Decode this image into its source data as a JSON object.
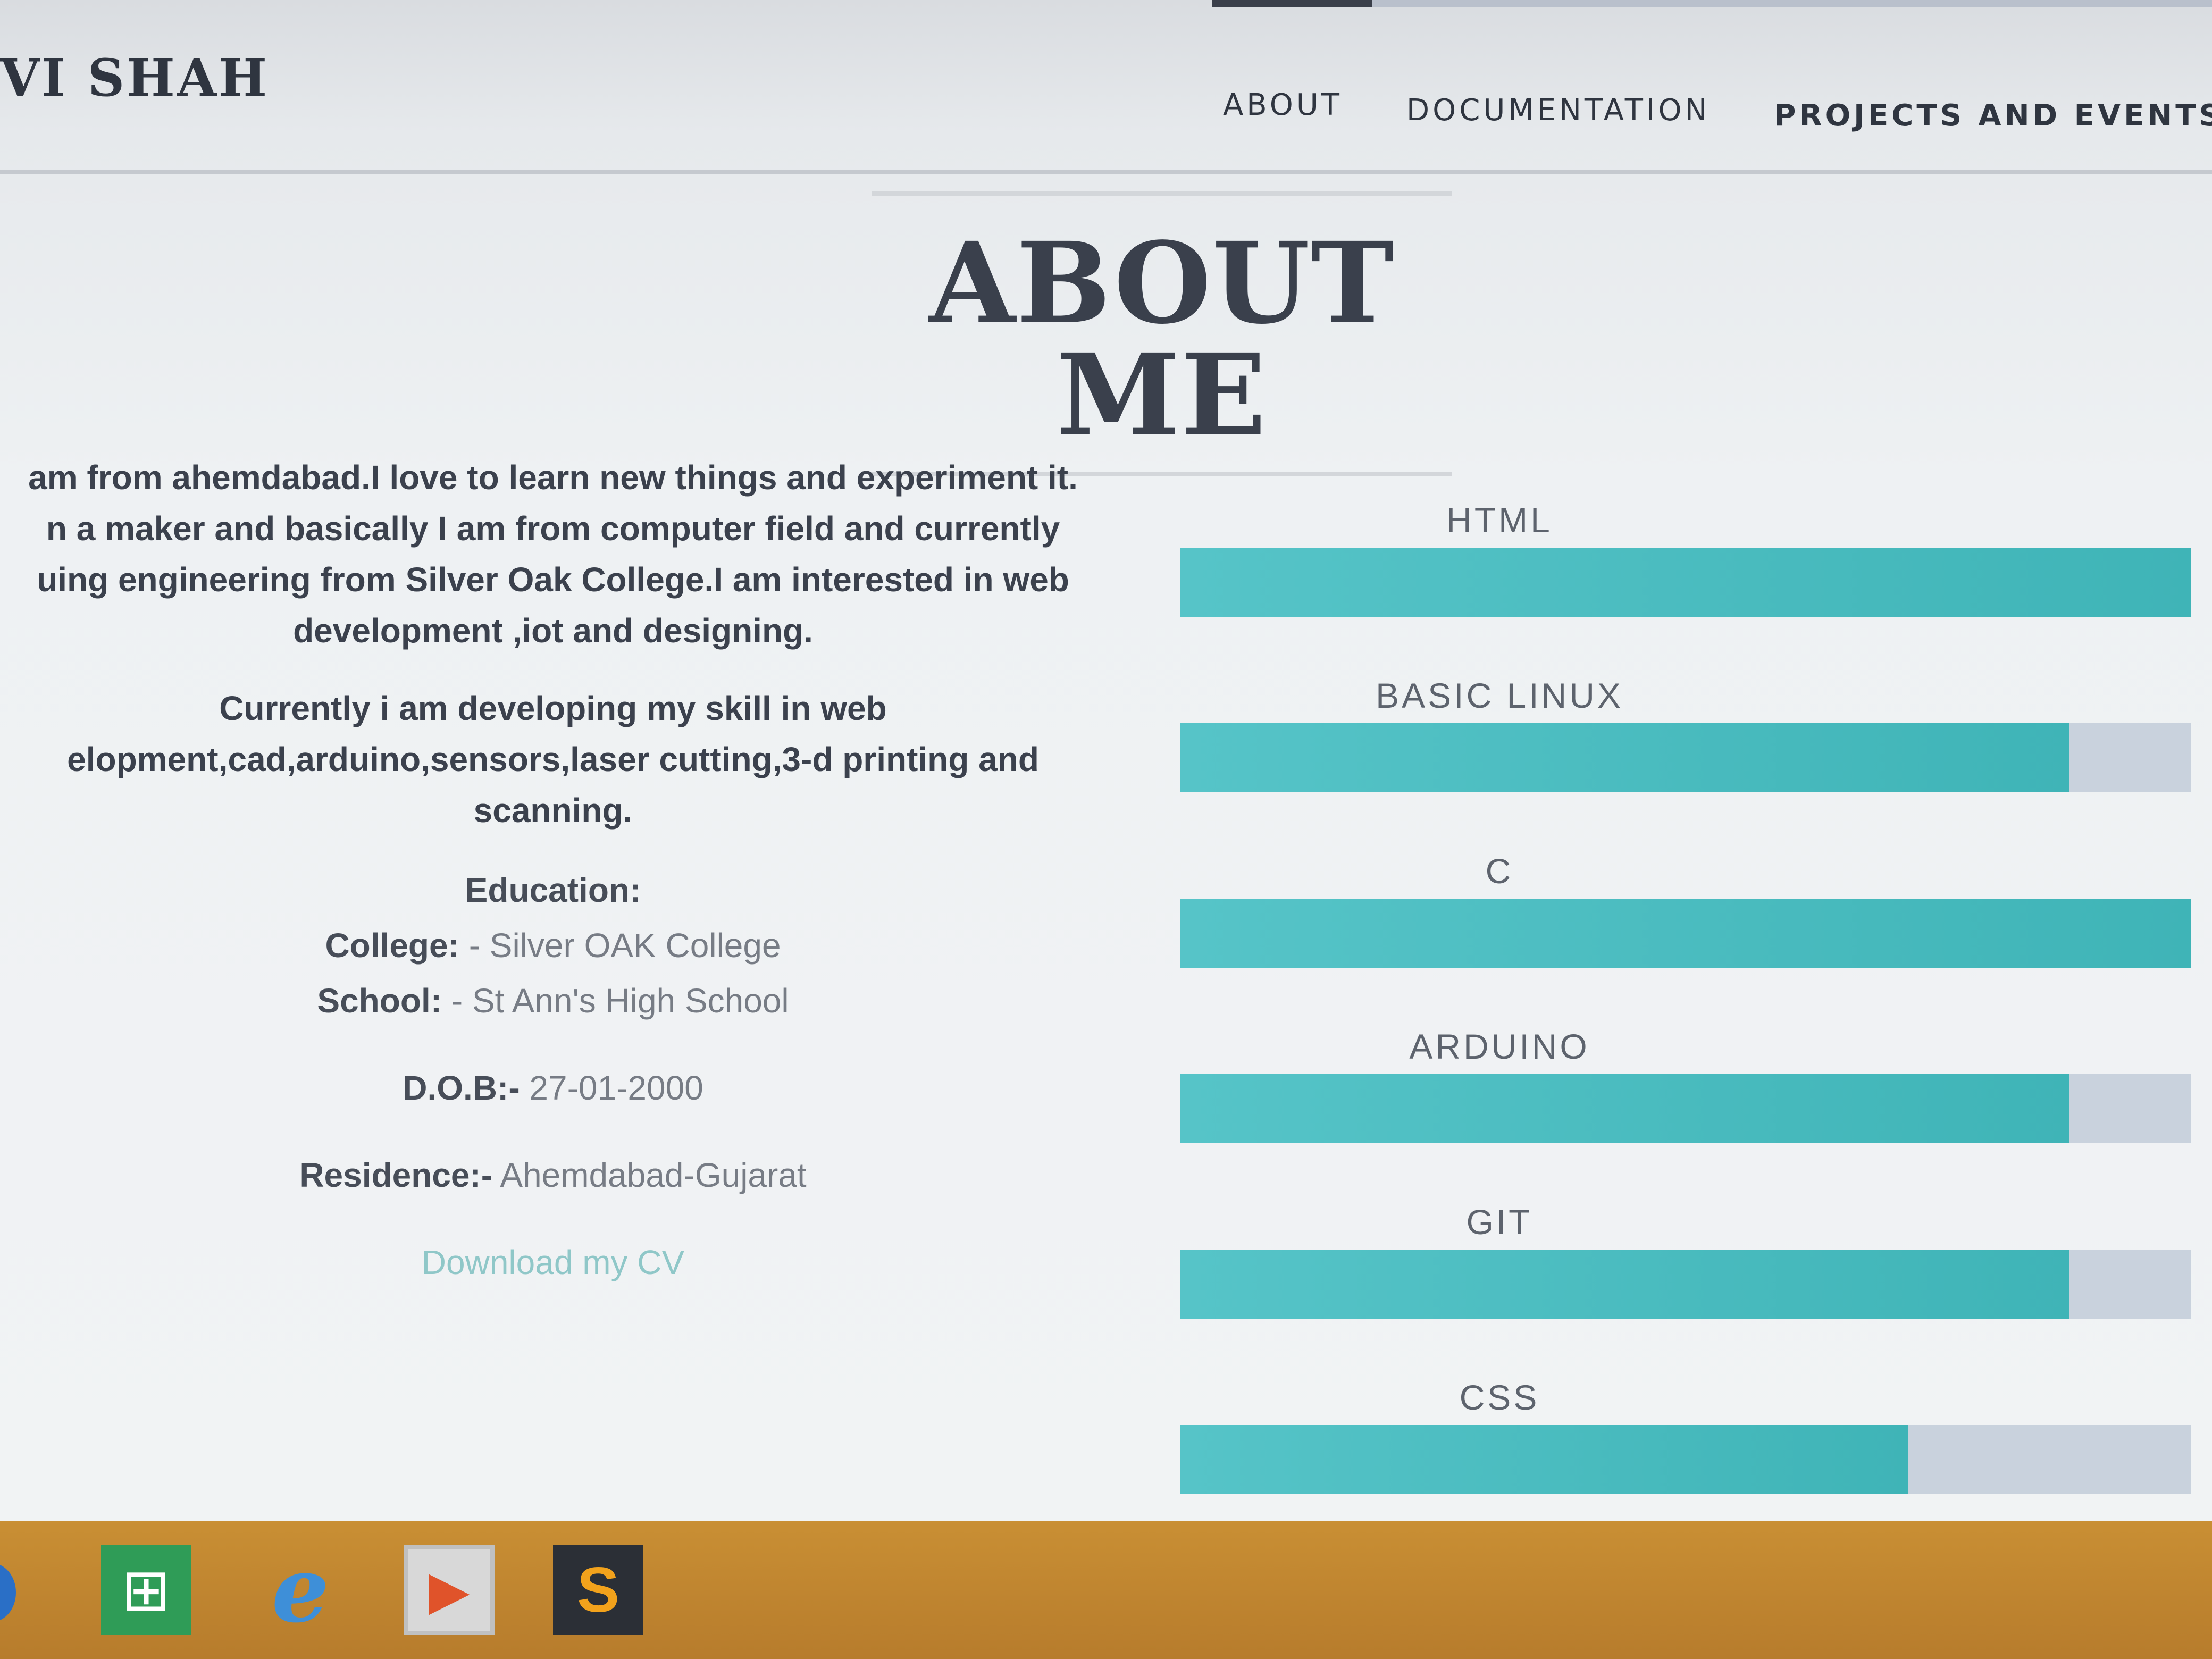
{
  "site": {
    "brand": "VI SHAH"
  },
  "nav": {
    "items": [
      {
        "label": "ABOUT"
      },
      {
        "label": "DOCUMENTATION"
      },
      {
        "label": "PROJECTS AND EVENTS"
      }
    ]
  },
  "about": {
    "title": "ABOUT ME",
    "paragraph1_lines": [
      "am from ahemdabad.I love to learn new things and experiment it.",
      "n a maker and basically I am from computer field and currently",
      "uing engineering from Silver Oak College.I am interested in web",
      "development ,iot and designing."
    ],
    "paragraph2_lines": [
      "Currently i am developing my skill in web",
      "elopment,cad,arduino,sensors,laser cutting,3-d printing and",
      "scanning."
    ],
    "education_heading": "Education:",
    "college_label": "College:",
    "college_value": "- Silver OAK College",
    "school_label": "School:",
    "school_value": "- St Ann's High School",
    "dob_label": "D.O.B:-",
    "dob_value": "27-01-2000",
    "residence_label": "Residence:-",
    "residence_value": "Ahemdabad-Gujarat",
    "download_label": "Download my CV"
  },
  "skills": [
    {
      "name": "HTML",
      "level": 1.0
    },
    {
      "name": "BASIC LINUX",
      "level": 0.88
    },
    {
      "name": "C",
      "level": 1.0
    },
    {
      "name": "ARDUINO",
      "level": 0.88
    },
    {
      "name": "GIT",
      "level": 0.88
    },
    {
      "name": "CSS",
      "level": 0.72
    }
  ],
  "taskbar": {
    "icons": [
      "store-icon",
      "internet-explorer-icon",
      "media-player-icon",
      "sublime-text-icon"
    ]
  },
  "colors": {
    "accent": "#4fbfc3",
    "title": "#3a404c",
    "link": "#8fc7c8",
    "taskbar": "#c98f34"
  }
}
